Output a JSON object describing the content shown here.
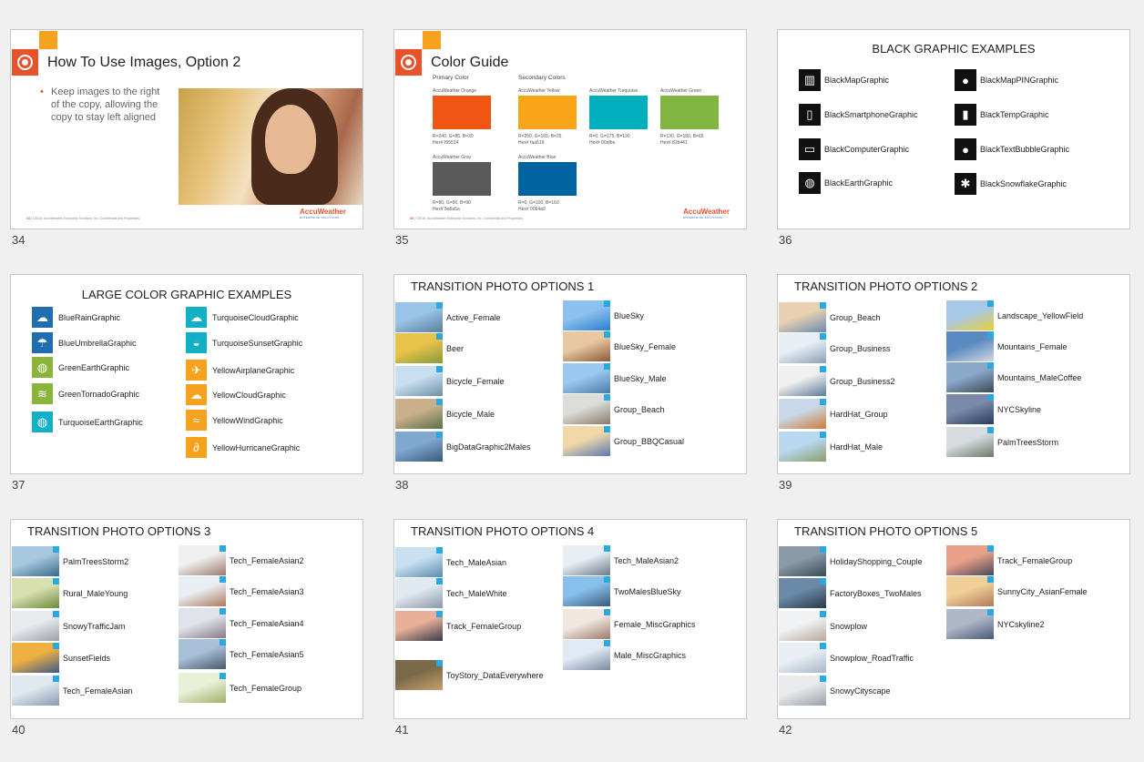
{
  "slides": {
    "s34": {
      "num": "34",
      "title": "How To Use Images, Option 2",
      "bullet": "Keep images to the right of the copy, allowing the copy to stay left aligned",
      "footer_num": "34",
      "footer_text": "©2016, AccuWeather Enterprise Solutions, Inc. Confidential and Proprietary",
      "logo": "AccuWeather",
      "logo_sub": "ENTERPRISE SOLUTIONS"
    },
    "s35": {
      "num": "35",
      "title": "Color Guide",
      "primary_label": "Primary Color",
      "secondary_label": "Secondary Colors",
      "footer_num": "35",
      "footer_text": "©2016, AccuWeather Enterprise Solutions, Inc. Confidential and Proprietary",
      "logo": "AccuWeather",
      "logo_sub": "ENTERPRISE SOLUTIONS",
      "swatches": [
        {
          "name": "AccuWeather Orange",
          "color": "#f05514",
          "rgb": "R=240, G=85, B=20",
          "hex": "Hex# f05514"
        },
        {
          "name": "AccuWeather Yellow",
          "color": "#faa519",
          "rgb": "R=250, G=165, B=25",
          "hex": "Hex# faa519"
        },
        {
          "name": "AccuWeather Turquoise",
          "color": "#00afbe",
          "rgb": "R=0, G=175, B=190",
          "hex": "Hex# 00afbe"
        },
        {
          "name": "AccuWeather Green",
          "color": "#82b441",
          "rgb": "R=130, G=180, B=65",
          "hex": "Hex# 82b441"
        },
        {
          "name": "AccuWeather Gray",
          "color": "#5a5a5a",
          "rgb": "R=90, G=90, B=90",
          "hex": "Hex# 5a5a5a"
        },
        {
          "name": "AccuWeather Blue",
          "color": "#0064a0",
          "rgb": "R=0, G=100, B=160",
          "hex": "Hex# 0064a0"
        }
      ]
    },
    "s36": {
      "num": "36",
      "title": "BLACK GRAPHIC EXAMPLES",
      "items": [
        {
          "label": "BlackMapGraphic",
          "icon": "map-icon",
          "glyph": "▥"
        },
        {
          "label": "BlackMapPINGraphic",
          "icon": "map-pin-icon",
          "glyph": "●"
        },
        {
          "label": "BlackSmartphoneGraphic",
          "icon": "smartphone-icon",
          "glyph": "▯"
        },
        {
          "label": "BlackTempGraphic",
          "icon": "thermometer-icon",
          "glyph": "▮"
        },
        {
          "label": "BlackComputerGraphic",
          "icon": "computer-icon",
          "glyph": "▭"
        },
        {
          "label": "BlackTextBubbleGraphic",
          "icon": "text-bubble-icon",
          "glyph": "●"
        },
        {
          "label": "BlackEarthGraphic",
          "icon": "earth-icon",
          "glyph": "◍"
        },
        {
          "label": "BlackSnowflakeGraphic",
          "icon": "snowflake-icon",
          "glyph": "✱"
        }
      ]
    },
    "s37": {
      "num": "37",
      "title": "LARGE COLOR GRAPHIC EXAMPLES",
      "left": [
        {
          "label": "BlueRainGraphic",
          "icon": "rain-cloud-icon",
          "glyph": "☁",
          "color": "c-blue"
        },
        {
          "label": "BlueUmbrellaGraphic",
          "icon": "umbrella-icon",
          "glyph": "☂",
          "color": "c-blue"
        },
        {
          "label": "GreenEarthGraphic",
          "icon": "earth-icon",
          "glyph": "◍",
          "color": "c-green"
        },
        {
          "label": "GreenTornadoGraphic",
          "icon": "tornado-icon",
          "glyph": "≋",
          "color": "c-green"
        },
        {
          "label": "TurquoiseEarthGraphic",
          "icon": "earth-icon",
          "glyph": "◍",
          "color": "c-turq"
        }
      ],
      "right": [
        {
          "label": "TurquoiseCloudGraphic",
          "icon": "cloud-icon",
          "glyph": "☁",
          "color": "c-turq"
        },
        {
          "label": "TurquoiseSunsetGraphic",
          "icon": "sunset-icon",
          "glyph": "◒",
          "color": "c-turq"
        },
        {
          "label": "YellowAirplaneGraphic",
          "icon": "airplane-icon",
          "glyph": "✈",
          "color": "c-yellow"
        },
        {
          "label": "YellowCloudGraphic",
          "icon": "cloud-icon",
          "glyph": "☁",
          "color": "c-yellow"
        },
        {
          "label": "YellowWindGraphic",
          "icon": "wind-icon",
          "glyph": "≈",
          "color": "c-yellow"
        },
        {
          "label": "YellowHurricaneGraphic",
          "icon": "hurricane-icon",
          "glyph": "∂",
          "color": "c-yellow"
        }
      ]
    },
    "s38": {
      "num": "38",
      "title": "TRANSITION PHOTO OPTIONS 1",
      "left": [
        {
          "label": "Active_Female",
          "c1": "#9ac3e8",
          "c2": "#5a7f9a"
        },
        {
          "label": "Beer",
          "c1": "#e9c24a",
          "c2": "#8a9a3a"
        },
        {
          "label": "Bicycle_Female",
          "c1": "#c8dff0",
          "c2": "#6d8fa8"
        },
        {
          "label": "Bicycle_Male",
          "c1": "#c9b08a",
          "c2": "#5a6f4a"
        },
        {
          "label": "BigDataGraphic2Males",
          "c1": "#7fa8d0",
          "c2": "#3a5a7a"
        }
      ],
      "right": [
        {
          "label": "BlueSky",
          "c1": "#8cc0ee",
          "c2": "#2a7fd0"
        },
        {
          "label": "BlueSky_Female",
          "c1": "#e8c8a0",
          "c2": "#8a5a3a"
        },
        {
          "label": "BlueSky_Male",
          "c1": "#9ac8f0",
          "c2": "#4a7aa8"
        },
        {
          "label": "Group_Beach",
          "c1": "#dcdcd8",
          "c2": "#8a7a6a"
        },
        {
          "label": "Group_BBQCasual",
          "c1": "#f0d8a8",
          "c2": "#5a7ab0"
        }
      ]
    },
    "s39": {
      "num": "39",
      "title": "TRANSITION PHOTO OPTIONS 2",
      "left": [
        {
          "label": "Group_Beach",
          "c1": "#e8d0b0",
          "c2": "#6a8ab0"
        },
        {
          "label": "Group_Business",
          "c1": "#e8eef4",
          "c2": "#8aa0b8"
        },
        {
          "label": "Group_Business2",
          "c1": "#f0f0f0",
          "c2": "#5a7a9a"
        },
        {
          "label": "HardHat_Group",
          "c1": "#c8d8e8",
          "c2": "#d07a3a"
        },
        {
          "label": "HardHat_Male",
          "c1": "#b8d8f0",
          "c2": "#8aa06a"
        }
      ],
      "right": [
        {
          "label": "Landscape_YellowField",
          "c1": "#a8c8e8",
          "c2": "#e8d03a"
        },
        {
          "label": "Mountains_Female",
          "c1": "#5a8ac0",
          "c2": "#d0d8e0"
        },
        {
          "label": "Mountains_MaleCoffee",
          "c1": "#8aa8c8",
          "c2": "#3a4a5a"
        },
        {
          "label": "NYCSkyline",
          "c1": "#7a8aa8",
          "c2": "#2a3a5a"
        },
        {
          "label": "PalmTreesStorm",
          "c1": "#d8dce0",
          "c2": "#6a7a6a"
        }
      ]
    },
    "s40": {
      "num": "40",
      "title": "TRANSITION PHOTO OPTIONS 3",
      "left": [
        {
          "label": "PalmTreesStorm2",
          "c1": "#a8c8e0",
          "c2": "#3a6a8a"
        },
        {
          "label": "Rural_MaleYoung",
          "c1": "#d8e0b0",
          "c2": "#6a8a3a"
        },
        {
          "label": "SnowyTrafficJam",
          "c1": "#e8eaee",
          "c2": "#9aa0a8"
        },
        {
          "label": "SunsetFields",
          "c1": "#f0b040",
          "c2": "#3a5a8a"
        },
        {
          "label": "Tech_FemaleAsian",
          "c1": "#e0e8f0",
          "c2": "#8a9ab0"
        }
      ],
      "right": [
        {
          "label": "Tech_FemaleAsian2",
          "c1": "#f0f0f0",
          "c2": "#9a7a6a"
        },
        {
          "label": "Tech_FemaleAsian3",
          "c1": "#e8eef4",
          "c2": "#b07a5a"
        },
        {
          "label": "Tech_FemaleAsian4",
          "c1": "#e0e4ea",
          "c2": "#8a7a8a"
        },
        {
          "label": "Tech_FemaleAsian5",
          "c1": "#a8c0d8",
          "c2": "#4a5a6a"
        },
        {
          "label": "Tech_FemaleGroup",
          "c1": "#e8f0d8",
          "c2": "#a0b06a"
        }
      ]
    },
    "s41": {
      "num": "41",
      "title": "TRANSITION PHOTO OPTIONS 4",
      "left": [
        {
          "label": "Tech_MaleAsian",
          "c1": "#c8e0f0",
          "c2": "#5a8ab0"
        },
        {
          "label": "Tech_MaleWhite",
          "c1": "#e0e8f0",
          "c2": "#8a98a8"
        },
        {
          "label": "Track_FemaleGroup",
          "c1": "#e8b098",
          "c2": "#3a3a4a"
        },
        {
          "label": "ToyStory_DataEverywhere",
          "c1": "#7a6a4a",
          "c2": "#c8a06a"
        }
      ],
      "right": [
        {
          "label": "Tech_MaleAsian2",
          "c1": "#e8eef4",
          "c2": "#6a7a8a"
        },
        {
          "label": "TwoMalesBlueSky",
          "c1": "#88c0ec",
          "c2": "#3a5a7a"
        },
        {
          "label": "Female_MiscGraphics",
          "c1": "#f0e8e0",
          "c2": "#a07a6a"
        },
        {
          "label": "Male_MiscGraphics",
          "c1": "#e0eaf4",
          "c2": "#7a8aa0"
        }
      ]
    },
    "s42": {
      "num": "42",
      "title": "TRANSITION PHOTO OPTIONS 5",
      "left": [
        {
          "label": "HolidayShopping_Couple",
          "c1": "#8a9aa8",
          "c2": "#3a4a5a"
        },
        {
          "label": "FactoryBoxes_TwoMales",
          "c1": "#6a8aa8",
          "c2": "#2a3a4a"
        },
        {
          "label": "Snowplow",
          "c1": "#f0f2f4",
          "c2": "#b8a898"
        },
        {
          "label": "Snowplow_RoadTraffic",
          "c1": "#e8eef4",
          "c2": "#a8b8c8"
        },
        {
          "label": "SnowyCityscape",
          "c1": "#e8eaec",
          "c2": "#9aa0a8"
        }
      ],
      "right": [
        {
          "label": "Track_FemaleGroup",
          "c1": "#e8a088",
          "c2": "#4a4a5a"
        },
        {
          "label": "SunnyCity_AsianFemale",
          "c1": "#f0d098",
          "c2": "#b07a5a"
        },
        {
          "label": "NYCskyline2",
          "c1": "#b0b8c8",
          "c2": "#4a5a7a"
        }
      ]
    }
  }
}
